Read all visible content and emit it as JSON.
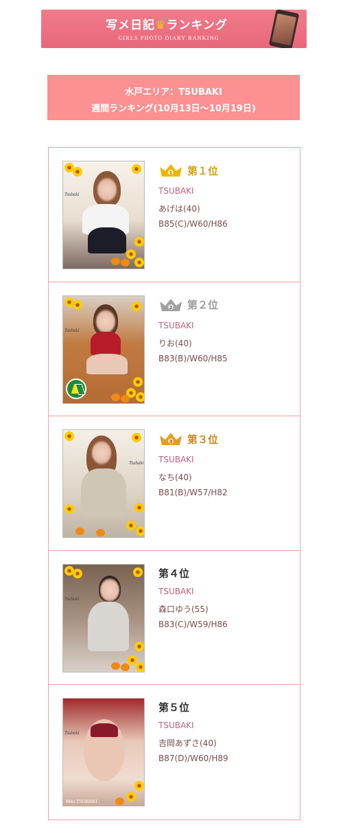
{
  "banner": {
    "title_pre": "写メ日記",
    "title_crown": "♛",
    "title_post": "ランキング",
    "subtitle": "GIRLS PHOTO DIARY RANKING"
  },
  "area": {
    "line1": "水戸エリア：TSUBAKI",
    "line2": "週間ランキング(10月13日〜10月19日)"
  },
  "ranking": [
    {
      "rank": "第１位",
      "crown": "gold",
      "crown_number": "1",
      "shop": "TSUBAKI",
      "name": "あげは(40)",
      "measurements": "B85(C)/W60/H86",
      "photo_logo": "Tsubaki",
      "rank_color": "#d4a017"
    },
    {
      "rank": "第２位",
      "crown": "silver",
      "crown_number": "2",
      "shop": "TSUBAKI",
      "name": "りお(40)",
      "measurements": "B83(B)/W60/H85",
      "photo_logo": "Tsubaki",
      "rank_color": "#9a9a9a"
    },
    {
      "rank": "第３位",
      "crown": "bronze",
      "crown_number": "3",
      "shop": "TSUBAKI",
      "name": "なち(40)",
      "measurements": "B81(B)/W57/H82",
      "photo_logo": "Tsubaki",
      "rank_color": "#c98a1c"
    },
    {
      "rank": "第４位",
      "crown": "none",
      "crown_number": "",
      "shop": "TSUBAKI",
      "name": "森口ゆう(55)",
      "measurements": "B83(C)/W59/H86",
      "photo_logo": "Tsubaki",
      "rank_color": "#333333"
    },
    {
      "rank": "第５位",
      "crown": "none",
      "crown_number": "",
      "shop": "TSUBAKI",
      "name": "吉岡あずさ(40)",
      "measurements": "B87(D)/W60/H89",
      "photo_logo": "Mito TSUBAKI",
      "rank_color": "#333333"
    }
  ],
  "colors": {
    "banner_bg": "#e8677a",
    "area_bg": "#fd9090",
    "list_border": "#f2a0a0",
    "gold": "#f0b400",
    "silver": "#a0a0a0",
    "bronze": "#e0a020",
    "shop_text": "#c0607a"
  }
}
